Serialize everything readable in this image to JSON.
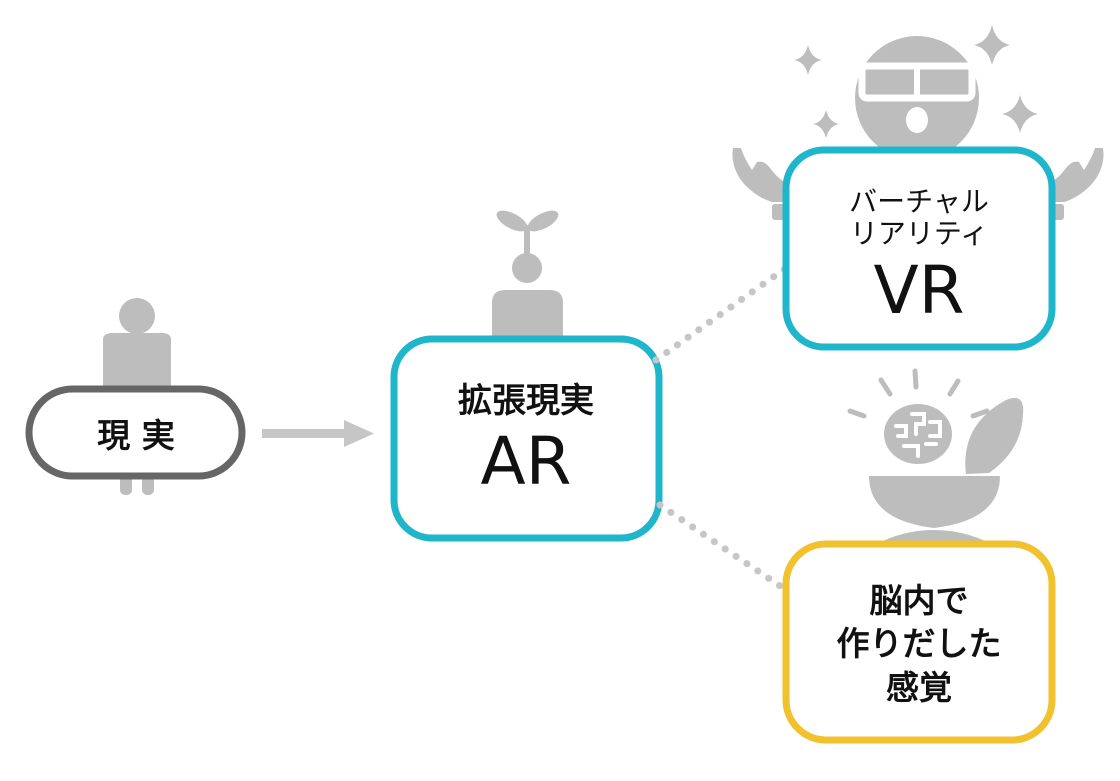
{
  "nodes": {
    "reality": {
      "label": "現 実"
    },
    "ar": {
      "sublabel": "拡張現実",
      "label": "AR"
    },
    "vr": {
      "sublabel_line1": "バーチャル",
      "sublabel_line2": "リアリティ",
      "label": "VR"
    },
    "brain": {
      "line1": "脳内で",
      "line2": "作りだした",
      "line3": "感覚"
    }
  },
  "colors": {
    "figure_gray": "#bdbdbd",
    "reality_border": "#666666",
    "ar_vr_border": "#1fb6cb",
    "brain_border": "#f2c12e",
    "connector_gray": "#c6c6c6",
    "text": "#111111"
  },
  "icons": {
    "reality_figure": "person-icon",
    "ar_figure": "sprout-person-icon",
    "vr_figure": "vr-headset-person-icon",
    "brain_figure": "open-head-brain-icon"
  }
}
